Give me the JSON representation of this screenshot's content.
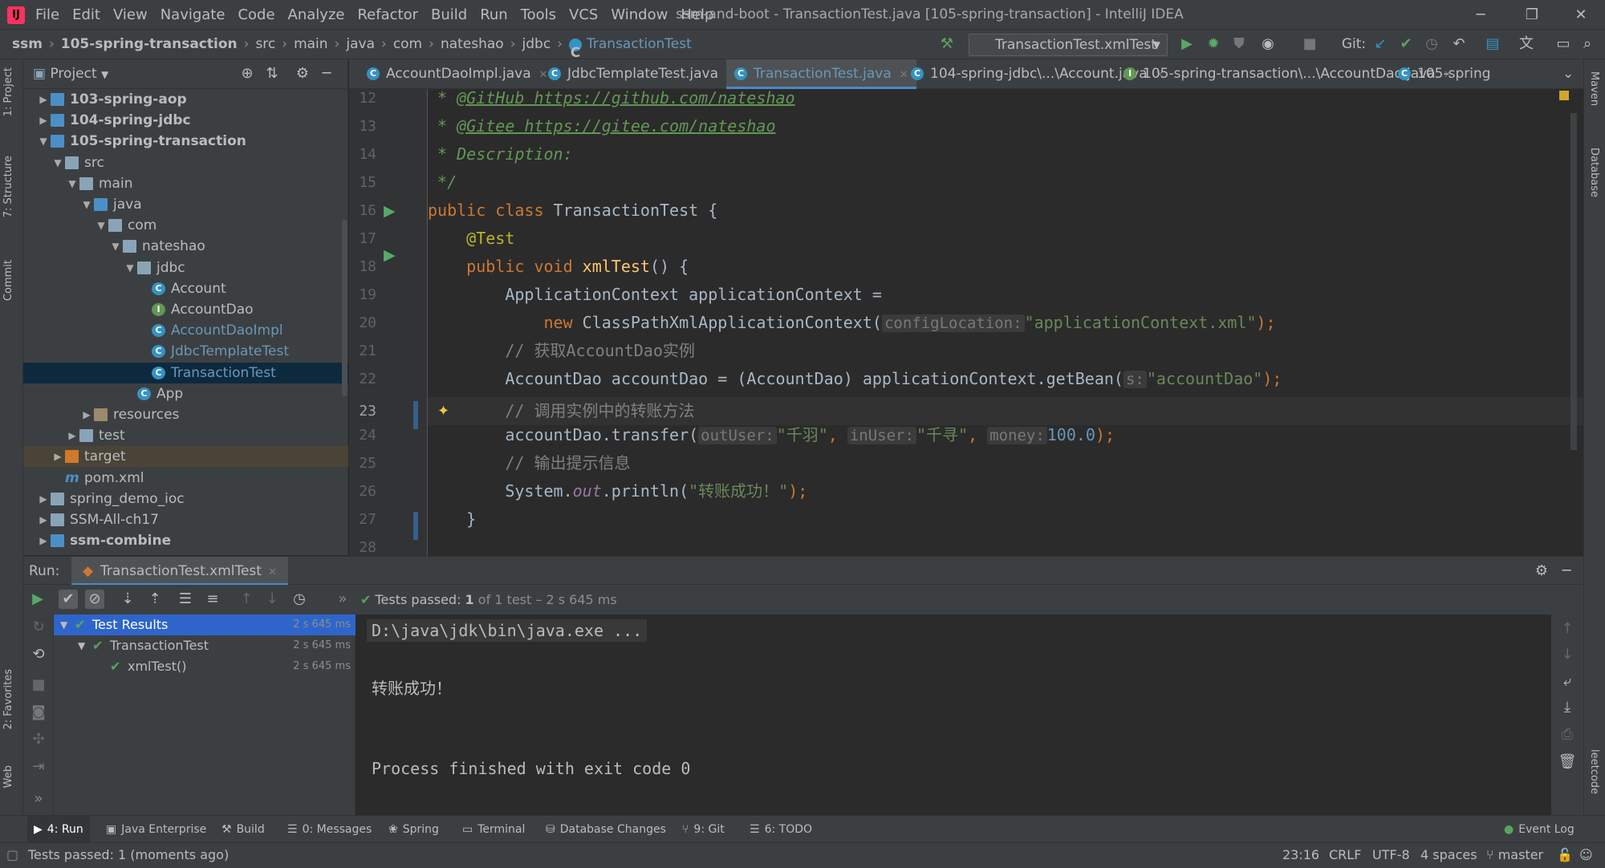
{
  "window": {
    "title": "ssm-and-boot - TransactionTest.java [105-spring-transaction] - IntelliJ IDEA",
    "menus": [
      "File",
      "Edit",
      "View",
      "Navigate",
      "Code",
      "Analyze",
      "Refactor",
      "Build",
      "Run",
      "Tools",
      "VCS",
      "Window",
      "Help"
    ]
  },
  "breadcrumbs": [
    "ssm",
    "105-spring-transaction",
    "src",
    "main",
    "java",
    "com",
    "nateshao",
    "jdbc",
    "TransactionTest"
  ],
  "toolbar": {
    "run_config": "TransactionTest.xmlTest",
    "git_label": "Git:"
  },
  "left_strip": {
    "project": "1: Project",
    "structure": "7: Structure",
    "commit": "Commit",
    "favorites": "2: Favorites",
    "web": "Web"
  },
  "right_strip": {
    "maven": "Maven",
    "database": "Database",
    "leetcode": "leetcode"
  },
  "project_panel": {
    "title": "Project",
    "tree": [
      {
        "label": "103-spring-aop",
        "level": 0,
        "arrow": "right",
        "icon": "module",
        "bold": true
      },
      {
        "label": "104-spring-jdbc",
        "level": 0,
        "arrow": "right",
        "icon": "module",
        "bold": true
      },
      {
        "label": "105-spring-transaction",
        "level": 0,
        "arrow": "down",
        "icon": "module",
        "bold": true
      },
      {
        "label": "src",
        "level": 1,
        "arrow": "down",
        "icon": "folder"
      },
      {
        "label": "main",
        "level": 2,
        "arrow": "down",
        "icon": "folder"
      },
      {
        "label": "java",
        "level": 3,
        "arrow": "down",
        "icon": "src"
      },
      {
        "label": "com",
        "level": 4,
        "arrow": "down",
        "icon": "pkg"
      },
      {
        "label": "nateshao",
        "level": 5,
        "arrow": "down",
        "icon": "pkg"
      },
      {
        "label": "jdbc",
        "level": 6,
        "arrow": "down",
        "icon": "pkg"
      },
      {
        "label": "Account",
        "level": 7,
        "icon": "class"
      },
      {
        "label": "AccountDao",
        "level": 7,
        "icon": "interface"
      },
      {
        "label": "AccountDaoImpl",
        "level": 7,
        "icon": "class",
        "blue": true
      },
      {
        "label": "JdbcTemplateTest",
        "level": 7,
        "icon": "test",
        "blue": true
      },
      {
        "label": "TransactionTest",
        "level": 7,
        "icon": "test",
        "blue": true,
        "selected": true
      },
      {
        "label": "App",
        "level": 6,
        "icon": "class"
      },
      {
        "label": "resources",
        "level": 3,
        "arrow": "right",
        "icon": "res"
      },
      {
        "label": "test",
        "level": 2,
        "arrow": "right",
        "icon": "folder"
      },
      {
        "label": "target",
        "level": 1,
        "arrow": "right",
        "icon": "exc",
        "hl": true
      },
      {
        "label": "pom.xml",
        "level": 1,
        "icon": "maven"
      },
      {
        "label": "spring_demo_ioc",
        "level": 0,
        "arrow": "right",
        "icon": "folder"
      },
      {
        "label": "SSM-All-ch17",
        "level": 0,
        "arrow": "right",
        "icon": "folder"
      },
      {
        "label": "ssm-combine",
        "level": 0,
        "arrow": "right",
        "icon": "module",
        "bold": true
      }
    ]
  },
  "editor_tabs": [
    {
      "label": "AccountDaoImpl.java",
      "icon": "class"
    },
    {
      "label": "JdbcTemplateTest.java",
      "icon": "test"
    },
    {
      "label": "TransactionTest.java",
      "icon": "test",
      "active": true
    },
    {
      "label": "104-spring-jdbc\\...\\Account.java",
      "icon": "class"
    },
    {
      "label": "105-spring-transaction\\...\\AccountDao.java",
      "icon": "interface"
    },
    {
      "label": "105-spring",
      "icon": "class"
    }
  ],
  "editor": {
    "line_numbers": [
      "12",
      "13",
      "14",
      "15",
      "16",
      "17",
      "18",
      "19",
      "20",
      "21",
      "22",
      "23",
      "24",
      "25",
      "26",
      "27",
      "28"
    ],
    "current_line": "23",
    "lines": {
      "l12_star": " * ",
      "l12_tag": "@GitHub",
      "l12_url": " https://github.com/nateshao",
      "l13_star": " * ",
      "l13_tag": "@Gitee",
      "l13_url": " https://gitee.com/nateshao",
      "l14": " * Description:",
      "l15": " */",
      "l16_kw": "public class ",
      "l16_name": "TransactionTest",
      "l16_end": " {",
      "l17": "    @Test",
      "l18_kw": "    public void ",
      "l18_fn": "xmlTest",
      "l18_end": "() {",
      "l19": "        ApplicationContext applicationContext =",
      "l20_kw": "            new ",
      "l20_call": "ClassPathXmlApplicationContext(",
      "l20_hint": "configLocation:",
      "l20_str": "\"applicationContext.xml\"",
      "l20_end": ");",
      "l21": "        // 获取AccountDao实例",
      "l22_a": "        AccountDao accountDao = (AccountDao) applicationContext.getBean(",
      "l22_hint": "s:",
      "l22_str": "\"accountDao\"",
      "l22_end": ");",
      "l23": "        // 调用实例中的转账方法",
      "l24_a": "        accountDao.transfer(",
      "l24_h1": "outUser:",
      "l24_s1": "\"千羽\"",
      "l24_c1": ", ",
      "l24_h2": "inUser:",
      "l24_s2": "\"千寻\"",
      "l24_c2": ", ",
      "l24_h3": "money:",
      "l24_num": "100.0",
      "l24_end": ");",
      "l25": "        // 输出提示信息",
      "l26_a": "        System.",
      "l26_out": "out",
      "l26_b": ".println(",
      "l26_str": "\"转账成功！\"",
      "l26_end": ");",
      "l27": "    }"
    }
  },
  "run_panel": {
    "label": "Run:",
    "tab": "TransactionTest.xmlTest",
    "status_prefix": "Tests passed: ",
    "status_count": "1",
    "status_suffix": " of 1 test – 2 s 645 ms",
    "results": [
      {
        "label": "Test Results",
        "time": "2 s 645 ms",
        "level": 0
      },
      {
        "label": "TransactionTest",
        "time": "2 s 645 ms",
        "level": 1
      },
      {
        "label": "xmlTest()",
        "time": "2 s 645 ms",
        "level": 2
      }
    ],
    "console": [
      "D:\\java\\jdk\\bin\\java.exe ...",
      "转账成功！",
      "Process finished with exit code 0"
    ]
  },
  "bottom_tabs": [
    "4: Run",
    "Java Enterprise",
    "Build",
    "0: Messages",
    "Spring",
    "Terminal",
    "Database Changes",
    "9: Git",
    "6: TODO",
    "Event Log"
  ],
  "status_bar": {
    "message": "Tests passed: 1 (moments ago)",
    "position": "23:16",
    "line_sep": "CRLF",
    "encoding": "UTF-8",
    "indent": "4 spaces",
    "branch": "master"
  },
  "colors": {
    "accent": "#4a88c7",
    "keyword": "#cc7832",
    "string": "#6a8759",
    "method": "#ffc66d",
    "pass": "#5ba35d"
  }
}
